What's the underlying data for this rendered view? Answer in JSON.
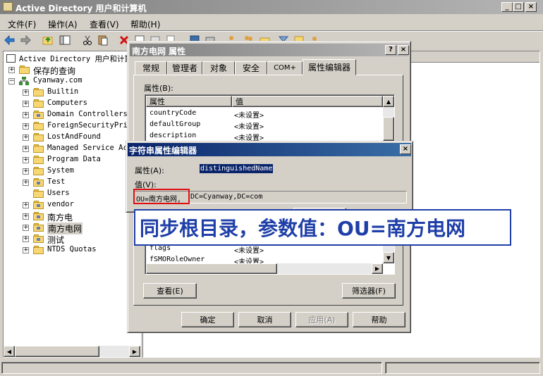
{
  "main_window": {
    "title": "Active Directory 用户和计算机",
    "menu": [
      "文件(F)",
      "操作(A)",
      "查看(V)",
      "帮助(H)"
    ]
  },
  "tree": {
    "root": "Active Directory 用户和计算",
    "saved_queries": "保存的查询",
    "domain": "Cyanway.com",
    "children": [
      "Builtin",
      "Computers",
      "Domain Controllers",
      "ForeignSecurityPrin",
      "LostAndFound",
      "Managed Service Acc",
      "Program Data",
      "System",
      "Test",
      "Users",
      "vendor",
      "南方电",
      "南方电网",
      "测试",
      "NTDS Quotas"
    ]
  },
  "props_dialog": {
    "title": "南方电网 属性",
    "help_btn": "?",
    "close_btn": "×",
    "tabs": [
      "常规",
      "管理者",
      "对象",
      "安全",
      "COM+",
      "属性编辑器"
    ],
    "attributes_label": "属性(B):",
    "col_attr": "属性",
    "col_value": "值",
    "rows_top": [
      {
        "attr": "countryCode",
        "value": "<未设置>"
      },
      {
        "attr": "defaultGroup",
        "value": "<未设置>"
      },
      {
        "attr": "description",
        "value": "<未设置>"
      }
    ],
    "rows_bottom": [
      {
        "attr": "flags",
        "value": "<未设置>"
      },
      {
        "attr": "fSMORoleOwner",
        "value": "<未设置>"
      }
    ],
    "view_btn": "查看(E)",
    "filter_btn": "筛选器(F)",
    "ok_btn": "确定",
    "cancel_btn": "取消",
    "apply_btn": "应用(A)",
    "help_btn2": "帮助"
  },
  "string_editor": {
    "title": "字符串属性编辑器",
    "close_btn": "×",
    "attribute_label": "属性(A):",
    "attribute_value": "distinguishedName",
    "value_label": "值(V):",
    "value_highlight": "OU=南方电网,",
    "value_rest": "DC=Cyanway,DC=com"
  },
  "annotation": {
    "text": "同步根目录，参数值：OU=南方电网",
    "color": "#1f3fa8"
  }
}
